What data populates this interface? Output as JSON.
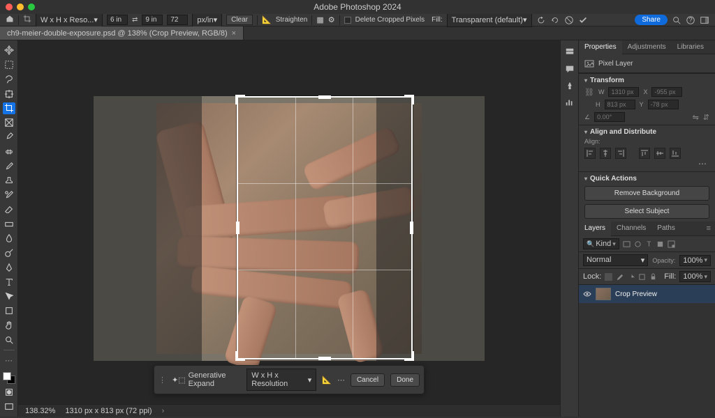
{
  "app_title": "Adobe Photoshop 2024",
  "doc_tab": "ch9-meier-double-exposure.psd @ 138% (Crop Preview, RGB/8)",
  "optbar": {
    "ratio_preset": "W x H x Reso...",
    "width": "6 in",
    "height": "9 in",
    "res": "72",
    "unit": "px/in",
    "clear": "Clear",
    "straighten": "Straighten",
    "delete_cropped": "Delete Cropped Pixels",
    "fill_label": "Fill:",
    "fill_value": "Transparent (default)"
  },
  "share": "Share",
  "context_bar": {
    "gen_expand": "Generative Expand",
    "preset": "W x H x Resolution",
    "cancel": "Cancel",
    "done": "Done"
  },
  "status": {
    "zoom": "138.32%",
    "dims": "1310 px x 813 px (72 ppi)"
  },
  "panels": {
    "properties": "Properties",
    "adjustments": "Adjustments",
    "libraries": "Libraries",
    "layer_type": "Pixel Layer",
    "transform": "Transform",
    "t_w": "1310 px",
    "t_x": "-955 px",
    "t_h": "813 px",
    "t_y": "-78 px",
    "t_angle": "0.00°",
    "align_dist": "Align and Distribute",
    "align_label": "Align:",
    "quick": "Quick Actions",
    "remove_bg": "Remove Background",
    "select_subj": "Select Subject",
    "layers": "Layers",
    "channels": "Channels",
    "paths": "Paths",
    "kind": "Kind",
    "blend": "Normal",
    "opacity_l": "Opacity:",
    "opacity_v": "100%",
    "lock_l": "Lock:",
    "fill_l": "Fill:",
    "fill_v": "100%",
    "layer_name": "Crop Preview"
  }
}
